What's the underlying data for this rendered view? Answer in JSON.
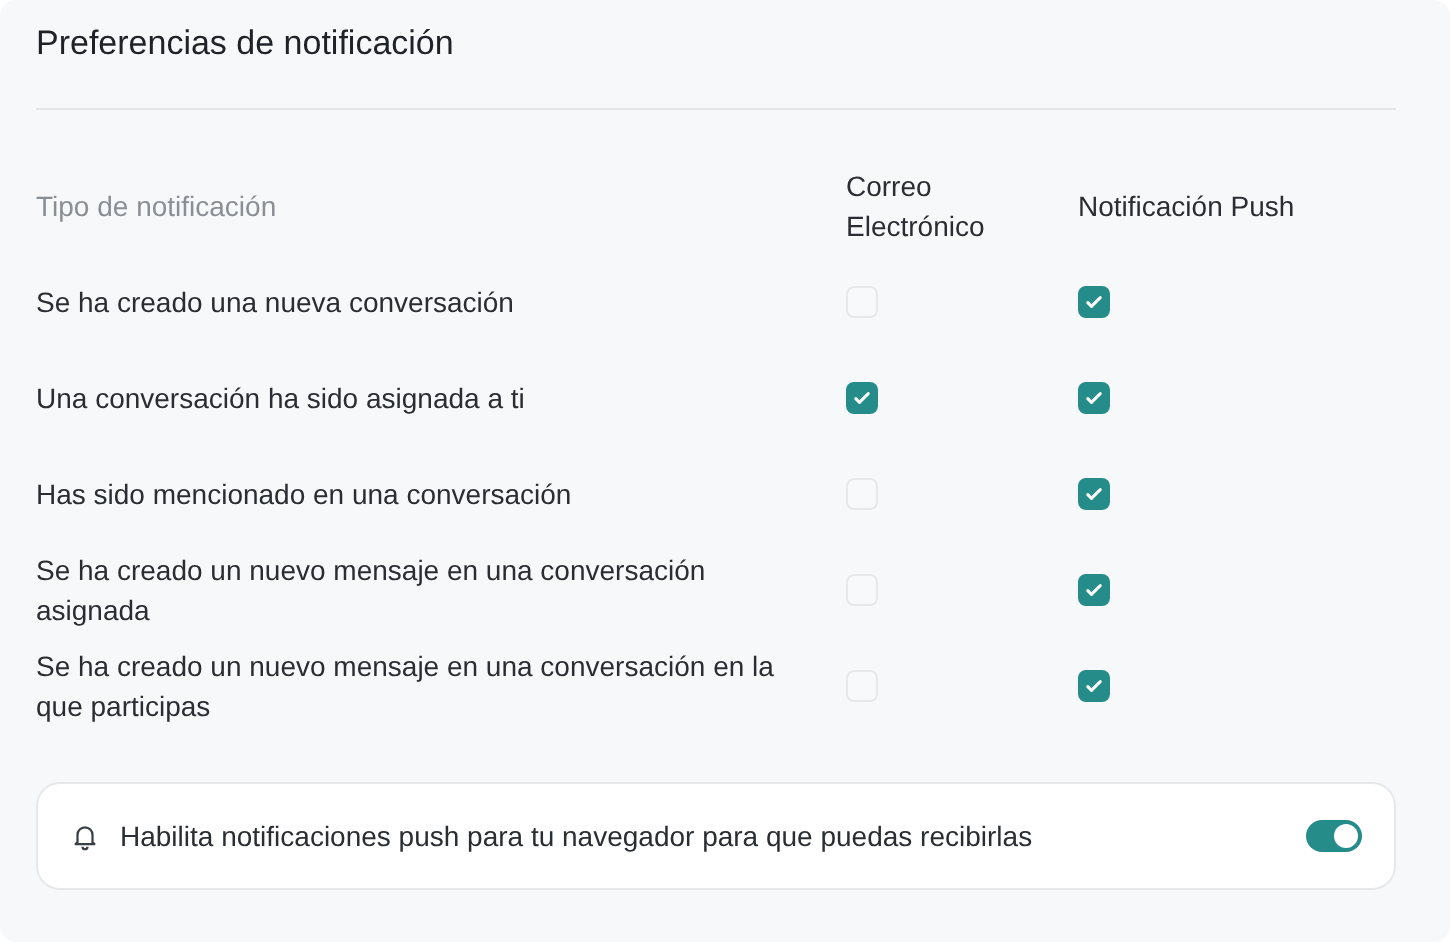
{
  "title": "Preferencias de notificación",
  "table": {
    "columns": [
      "Tipo de notificación",
      "Correo Electrónico",
      "Notificación Push"
    ],
    "rows": [
      {
        "label": "Se ha creado una nueva conversación",
        "email_checked": false,
        "push_checked": true
      },
      {
        "label": "Una conversación ha sido asignada a ti",
        "email_checked": true,
        "push_checked": true
      },
      {
        "label": "Has sido mencionado en una conversación",
        "email_checked": false,
        "push_checked": true
      },
      {
        "label": "Se ha creado un nuevo mensaje en una conversación asignada",
        "email_checked": false,
        "push_checked": true
      },
      {
        "label": "Se ha creado un nuevo mensaje en una conversación en la que participas",
        "email_checked": false,
        "push_checked": true
      }
    ]
  },
  "push_banner": {
    "text": "Habilita notificaciones push para tu navegador para que puedas recibirlas",
    "on": true
  }
}
